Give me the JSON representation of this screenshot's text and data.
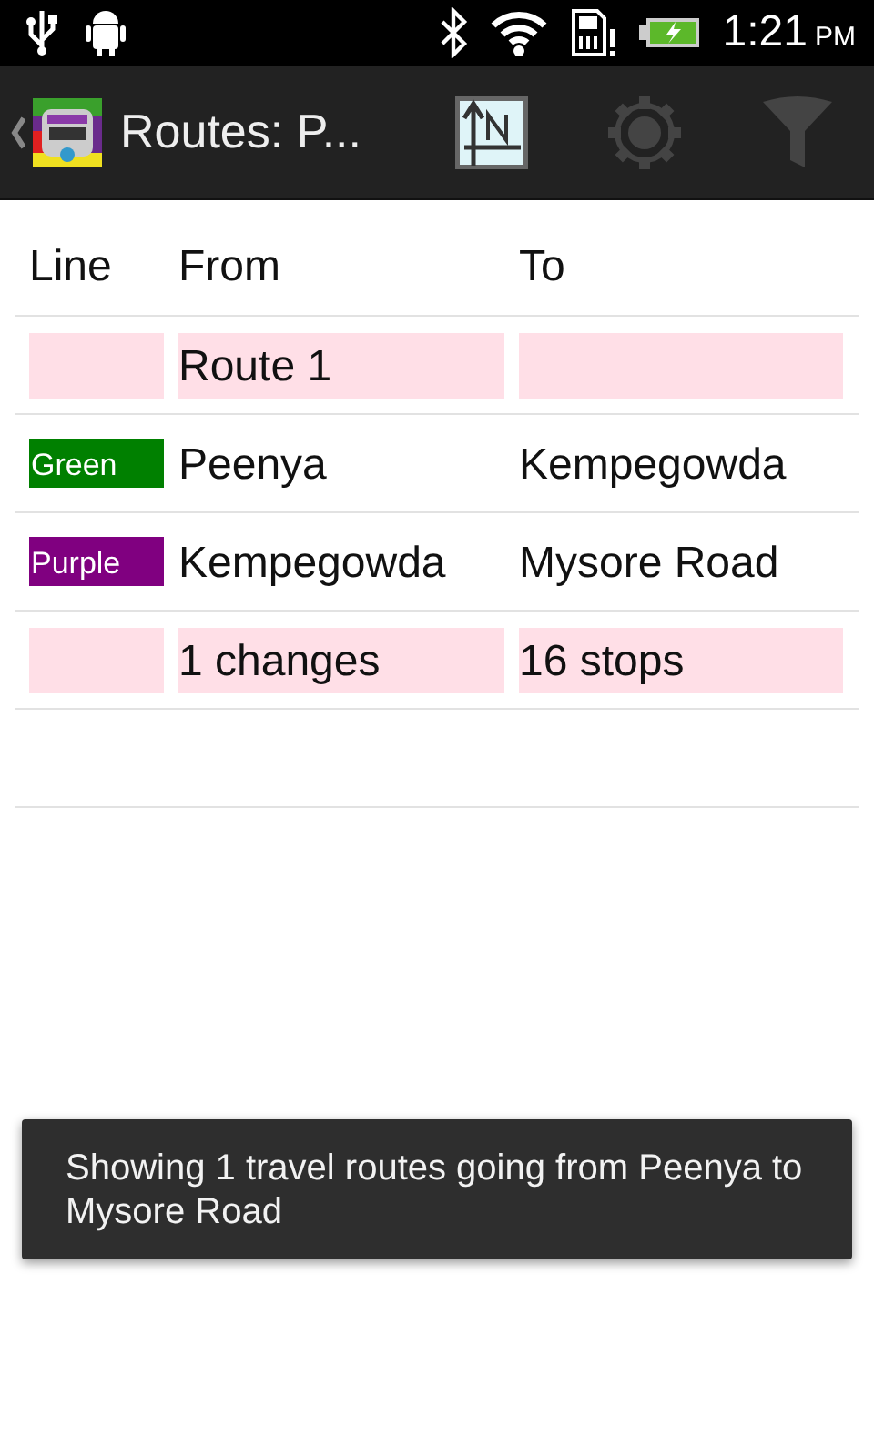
{
  "status_bar": {
    "time": "1:21",
    "ampm": "PM"
  },
  "action_bar": {
    "title": "Routes: P..."
  },
  "table": {
    "columns": [
      "Line",
      "From",
      "To"
    ],
    "rows": [
      {
        "kind": "summary",
        "cells": [
          "",
          "Route 1",
          ""
        ]
      },
      {
        "kind": "leg",
        "line": {
          "label": "Green",
          "color": "#008000"
        },
        "from": "Peenya",
        "to": "Kempegowda"
      },
      {
        "kind": "leg",
        "line": {
          "label": "Purple",
          "color": "#800080"
        },
        "from": "Kempegowda",
        "to": "Mysore Road"
      },
      {
        "kind": "summary",
        "cells": [
          "",
          "1 changes",
          "16 stops"
        ]
      }
    ]
  },
  "toast": {
    "message": "Showing 1 travel routes going from Peenya to Mysore Road"
  }
}
